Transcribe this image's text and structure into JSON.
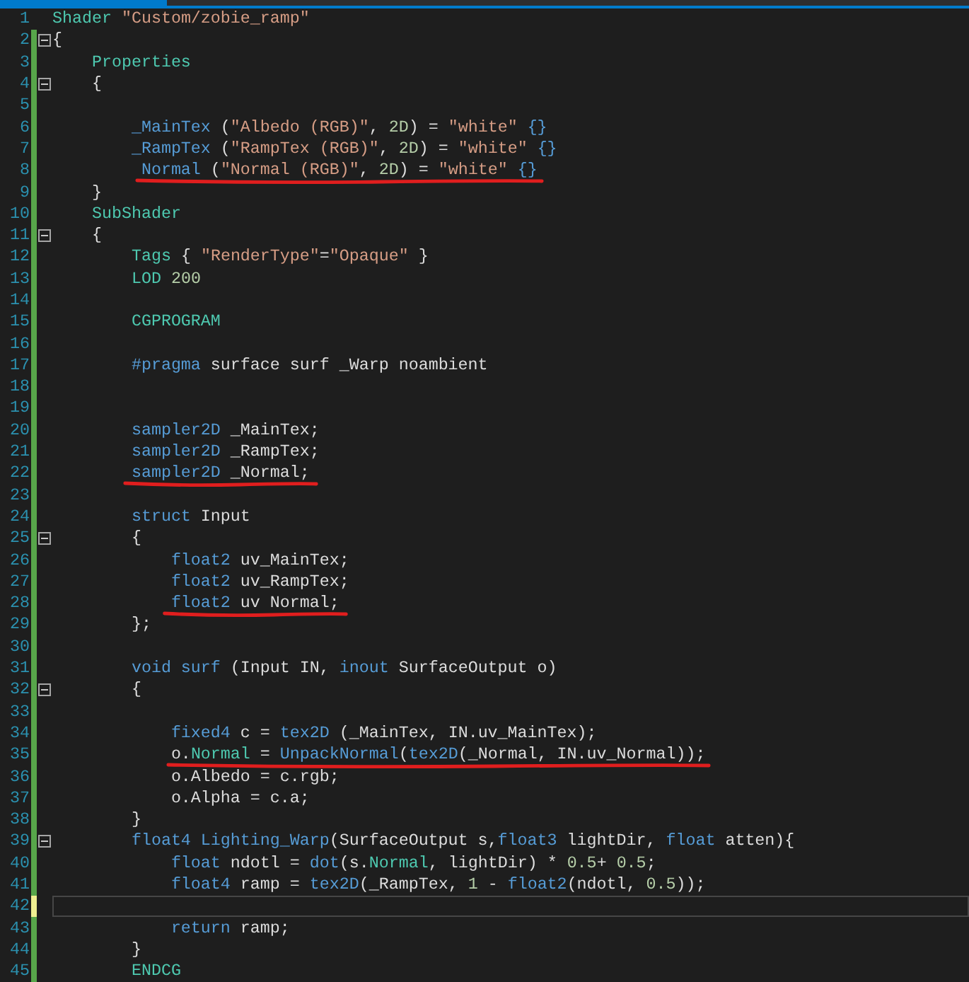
{
  "lines": [
    {
      "number": "1",
      "modified": false,
      "tokens": [
        {
          "text": "Shader ",
          "kind": "type"
        },
        {
          "text": "\"Custom/zobie_ramp\"",
          "kind": "string"
        }
      ]
    },
    {
      "number": "2",
      "modified": true,
      "saved": true,
      "fold": true,
      "tokens": [
        {
          "text": "{",
          "kind": "plain"
        }
      ]
    },
    {
      "number": "3",
      "modified": true,
      "saved": true,
      "tokens": [
        {
          "text": "    Properties",
          "kind": "type"
        }
      ]
    },
    {
      "number": "4",
      "modified": true,
      "saved": true,
      "fold": true,
      "tokens": [
        {
          "text": "    {",
          "kind": "plain"
        }
      ]
    },
    {
      "number": "5",
      "modified": true,
      "saved": true
    },
    {
      "number": "6",
      "modified": true,
      "saved": true,
      "tokens": [
        {
          "text": "        _MainTex",
          "kind": "keyword"
        },
        {
          "text": " (",
          "kind": "plain"
        },
        {
          "text": "\"Albedo (RGB)\"",
          "kind": "string"
        },
        {
          "text": ", ",
          "kind": "plain"
        },
        {
          "text": "2D",
          "kind": "number"
        },
        {
          "text": ") = ",
          "kind": "plain"
        },
        {
          "text": "\"white\" ",
          "kind": "string"
        },
        {
          "text": "{}",
          "kind": "keyword"
        }
      ]
    },
    {
      "number": "7",
      "modified": true,
      "saved": true,
      "tokens": [
        {
          "text": "        _RampTex",
          "kind": "keyword"
        },
        {
          "text": " (",
          "kind": "plain"
        },
        {
          "text": "\"RampTex (RGB)\"",
          "kind": "string"
        },
        {
          "text": ", ",
          "kind": "plain"
        },
        {
          "text": "2D",
          "kind": "number"
        },
        {
          "text": ") = ",
          "kind": "plain"
        },
        {
          "text": "\"white\" ",
          "kind": "string"
        },
        {
          "text": "{}",
          "kind": "keyword"
        }
      ]
    },
    {
      "number": "8",
      "modified": true,
      "saved": true,
      "underlined": true,
      "tokens": [
        {
          "text": "         Normal",
          "kind": "keyword"
        },
        {
          "text": " (",
          "kind": "plain"
        },
        {
          "text": "\"Normal (RGB)\"",
          "kind": "string"
        },
        {
          "text": ", ",
          "kind": "plain"
        },
        {
          "text": "2D",
          "kind": "number"
        },
        {
          "text": ") = ",
          "kind": "plain"
        },
        {
          "text": "\"white\" ",
          "kind": "string"
        },
        {
          "text": "{}",
          "kind": "keyword"
        }
      ]
    },
    {
      "number": "9",
      "modified": true,
      "saved": true,
      "tokens": [
        {
          "text": "    }",
          "kind": "plain"
        }
      ]
    },
    {
      "number": "10",
      "modified": true,
      "saved": true,
      "tokens": [
        {
          "text": "    SubShader",
          "kind": "type"
        }
      ]
    },
    {
      "number": "11",
      "modified": true,
      "saved": true,
      "fold": true,
      "tokens": [
        {
          "text": "    {",
          "kind": "plain"
        }
      ]
    },
    {
      "number": "12",
      "modified": true,
      "saved": true,
      "tokens": [
        {
          "text": "        Tags",
          "kind": "type"
        },
        {
          "text": " { ",
          "kind": "plain"
        },
        {
          "text": "\"RenderType\"",
          "kind": "string"
        },
        {
          "text": "=",
          "kind": "plain"
        },
        {
          "text": "\"Opaque\"",
          "kind": "string"
        },
        {
          "text": " }",
          "kind": "plain"
        }
      ]
    },
    {
      "number": "13",
      "modified": true,
      "saved": true,
      "tokens": [
        {
          "text": "        LOD ",
          "kind": "type"
        },
        {
          "text": "200",
          "kind": "number"
        }
      ]
    },
    {
      "number": "14",
      "modified": true,
      "saved": true
    },
    {
      "number": "15",
      "modified": true,
      "saved": true,
      "tokens": [
        {
          "text": "        CGPROGRAM",
          "kind": "type"
        }
      ]
    },
    {
      "number": "16",
      "modified": true,
      "saved": true
    },
    {
      "number": "17",
      "modified": true,
      "saved": true,
      "tokens": [
        {
          "text": "        #pragma",
          "kind": "keyword"
        },
        {
          "text": " surface surf _Warp noambient",
          "kind": "plain"
        }
      ]
    },
    {
      "number": "18",
      "modified": true,
      "saved": true
    },
    {
      "number": "19",
      "modified": true,
      "saved": true
    },
    {
      "number": "20",
      "modified": true,
      "saved": true,
      "tokens": [
        {
          "text": "        sampler2D",
          "kind": "keyword"
        },
        {
          "text": " _MainTex;",
          "kind": "plain"
        }
      ]
    },
    {
      "number": "21",
      "modified": true,
      "saved": true,
      "tokens": [
        {
          "text": "        sampler2D",
          "kind": "keyword"
        },
        {
          "text": " _RampTex;",
          "kind": "plain"
        }
      ]
    },
    {
      "number": "22",
      "modified": true,
      "saved": true,
      "underlined": true,
      "tokens": [
        {
          "text": "        sampler2D",
          "kind": "keyword"
        },
        {
          "text": " _Normal;",
          "kind": "plain"
        }
      ]
    },
    {
      "number": "23",
      "modified": true,
      "saved": true
    },
    {
      "number": "24",
      "modified": true,
      "saved": true,
      "tokens": [
        {
          "text": "        struct",
          "kind": "keyword"
        },
        {
          "text": " Input",
          "kind": "plain"
        }
      ]
    },
    {
      "number": "25",
      "modified": true,
      "saved": true,
      "fold": true,
      "tokens": [
        {
          "text": "        {",
          "kind": "plain"
        }
      ]
    },
    {
      "number": "26",
      "modified": true,
      "saved": true,
      "tokens": [
        {
          "text": "            float2",
          "kind": "keyword"
        },
        {
          "text": " uv_MainTex;",
          "kind": "plain"
        }
      ]
    },
    {
      "number": "27",
      "modified": true,
      "saved": true,
      "tokens": [
        {
          "text": "            float2",
          "kind": "keyword"
        },
        {
          "text": " uv_RampTex;",
          "kind": "plain"
        }
      ]
    },
    {
      "number": "28",
      "modified": true,
      "saved": true,
      "underlined": true,
      "tokens": [
        {
          "text": "            float2",
          "kind": "keyword"
        },
        {
          "text": " uv Normal;",
          "kind": "plain"
        }
      ]
    },
    {
      "number": "29",
      "modified": true,
      "saved": true,
      "tokens": [
        {
          "text": "        };",
          "kind": "plain"
        }
      ]
    },
    {
      "number": "30",
      "modified": true,
      "saved": true
    },
    {
      "number": "31",
      "modified": true,
      "saved": true,
      "tokens": [
        {
          "text": "        void surf",
          "kind": "keyword"
        },
        {
          "text": " (Input IN, ",
          "kind": "plain"
        },
        {
          "text": "inout",
          "kind": "keyword"
        },
        {
          "text": " SurfaceOutput o)",
          "kind": "plain"
        }
      ]
    },
    {
      "number": "32",
      "modified": true,
      "saved": true,
      "fold": true,
      "tokens": [
        {
          "text": "        {",
          "kind": "plain"
        }
      ]
    },
    {
      "number": "33",
      "modified": true,
      "saved": true
    },
    {
      "number": "34",
      "modified": true,
      "saved": true,
      "tokens": [
        {
          "text": "            fixed4",
          "kind": "keyword"
        },
        {
          "text": " c = ",
          "kind": "plain"
        },
        {
          "text": "tex2D",
          "kind": "keyword"
        },
        {
          "text": " (_MainTex, IN.uv_MainTex);",
          "kind": "plain"
        }
      ]
    },
    {
      "number": "35",
      "modified": true,
      "saved": true,
      "underlined": true,
      "tokens": [
        {
          "text": "            o.",
          "kind": "plain"
        },
        {
          "text": "Normal",
          "kind": "type"
        },
        {
          "text": " = ",
          "kind": "plain"
        },
        {
          "text": "UnpackNormal",
          "kind": "keyword"
        },
        {
          "text": "(",
          "kind": "plain"
        },
        {
          "text": "tex2D",
          "kind": "keyword"
        },
        {
          "text": "(_Normal, IN.uv_Normal));",
          "kind": "plain"
        }
      ]
    },
    {
      "number": "36",
      "modified": true,
      "saved": true,
      "tokens": [
        {
          "text": "            o.Albedo = c.rgb;",
          "kind": "plain"
        }
      ]
    },
    {
      "number": "37",
      "modified": true,
      "saved": true,
      "tokens": [
        {
          "text": "            o.Alpha = c.a;",
          "kind": "plain"
        }
      ]
    },
    {
      "number": "38",
      "modified": true,
      "saved": true,
      "tokens": [
        {
          "text": "        }",
          "kind": "plain"
        }
      ]
    },
    {
      "number": "39",
      "modified": true,
      "saved": true,
      "fold": true,
      "tokens": [
        {
          "text": "        float4 Lighting_Warp",
          "kind": "keyword"
        },
        {
          "text": "(SurfaceOutput s,",
          "kind": "plain"
        },
        {
          "text": "float3",
          "kind": "keyword"
        },
        {
          "text": " lightDir, ",
          "kind": "plain"
        },
        {
          "text": "float",
          "kind": "keyword"
        },
        {
          "text": " atten){",
          "kind": "plain"
        }
      ]
    },
    {
      "number": "40",
      "modified": true,
      "saved": true,
      "tokens": [
        {
          "text": "            float",
          "kind": "keyword"
        },
        {
          "text": " ndotl = ",
          "kind": "plain"
        },
        {
          "text": "dot",
          "kind": "keyword"
        },
        {
          "text": "(s.",
          "kind": "plain"
        },
        {
          "text": "Normal",
          "kind": "type"
        },
        {
          "text": ", lightDir) * ",
          "kind": "plain"
        },
        {
          "text": "0.5",
          "kind": "number"
        },
        {
          "text": "+ ",
          "kind": "plain"
        },
        {
          "text": "0.5",
          "kind": "number"
        },
        {
          "text": ";",
          "kind": "plain"
        }
      ]
    },
    {
      "number": "41",
      "modified": true,
      "saved": true,
      "tokens": [
        {
          "text": "            float4",
          "kind": "keyword"
        },
        {
          "text": " ramp = ",
          "kind": "plain"
        },
        {
          "text": "tex2D",
          "kind": "keyword"
        },
        {
          "text": "(_RampTex, ",
          "kind": "plain"
        },
        {
          "text": "1",
          "kind": "number"
        },
        {
          "text": " - ",
          "kind": "plain"
        },
        {
          "text": "float2",
          "kind": "keyword"
        },
        {
          "text": "(ndotl, ",
          "kind": "plain"
        },
        {
          "text": "0.5",
          "kind": "number"
        },
        {
          "text": "));",
          "kind": "plain"
        }
      ]
    },
    {
      "number": "42",
      "modified": true,
      "saved": false,
      "current": true
    },
    {
      "number": "43",
      "modified": true,
      "saved": true,
      "tokens": [
        {
          "text": "            return",
          "kind": "keyword"
        },
        {
          "text": " ramp;",
          "kind": "plain"
        }
      ]
    },
    {
      "number": "44",
      "modified": true,
      "saved": true,
      "tokens": [
        {
          "text": "        }",
          "kind": "plain"
        }
      ]
    },
    {
      "number": "45",
      "modified": true,
      "saved": true,
      "tokens": [
        {
          "text": "        ENDCG",
          "kind": "type"
        }
      ]
    }
  ]
}
